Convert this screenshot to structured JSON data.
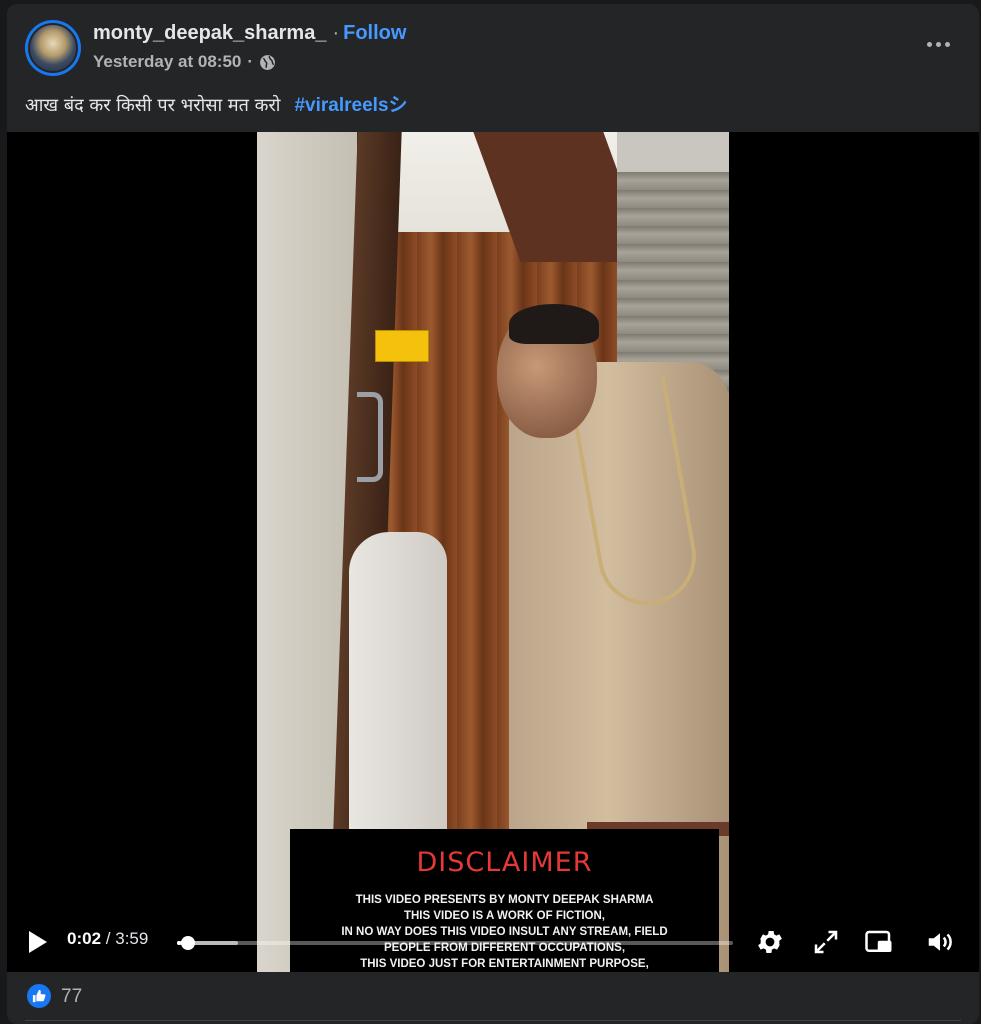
{
  "post": {
    "author": "monty_deepak_sharma_",
    "separator": "·",
    "follow_label": "Follow",
    "timestamp": "Yesterday at 08:50",
    "meta_separator": "·",
    "audience_icon": "globe-icon",
    "more_icon": "more-horizontal-icon",
    "caption_text": "आख बंद कर किसी पर भरोसा मत करो",
    "hashtag": "#viralreelsシ"
  },
  "video": {
    "disclaimer_title": "DISCLAIMER",
    "disclaimer_lines": [
      "THIS VIDEO PRESENTS BY MONTY DEEPAK SHARMA",
      "THIS VIDEO IS A WORK OF FICTION,",
      "IN NO WAY DOES THIS VIDEO INSULT ANY STREAM, FIELD",
      "PEOPLE FROM DIFFERENT OCCUPATIONS,",
      "THIS VIDEO JUST FOR ENTERTAINMENT PURPOSE,"
    ],
    "sign_text": "",
    "current_time": "0:02",
    "time_separator": "/",
    "duration": "3:59",
    "progress_fraction": 0.008,
    "buffer_fraction": 0.11,
    "icons": [
      "play-icon",
      "settings-icon",
      "fullscreen-icon",
      "picture-in-picture-icon",
      "volume-icon"
    ]
  },
  "reactions": {
    "like_count": "77",
    "icon": "like-icon"
  },
  "colors": {
    "background": "#18191a",
    "card": "#242526",
    "accent": "#4599ff",
    "like": "#1877f2",
    "disclaimer_title": "#e53935"
  }
}
